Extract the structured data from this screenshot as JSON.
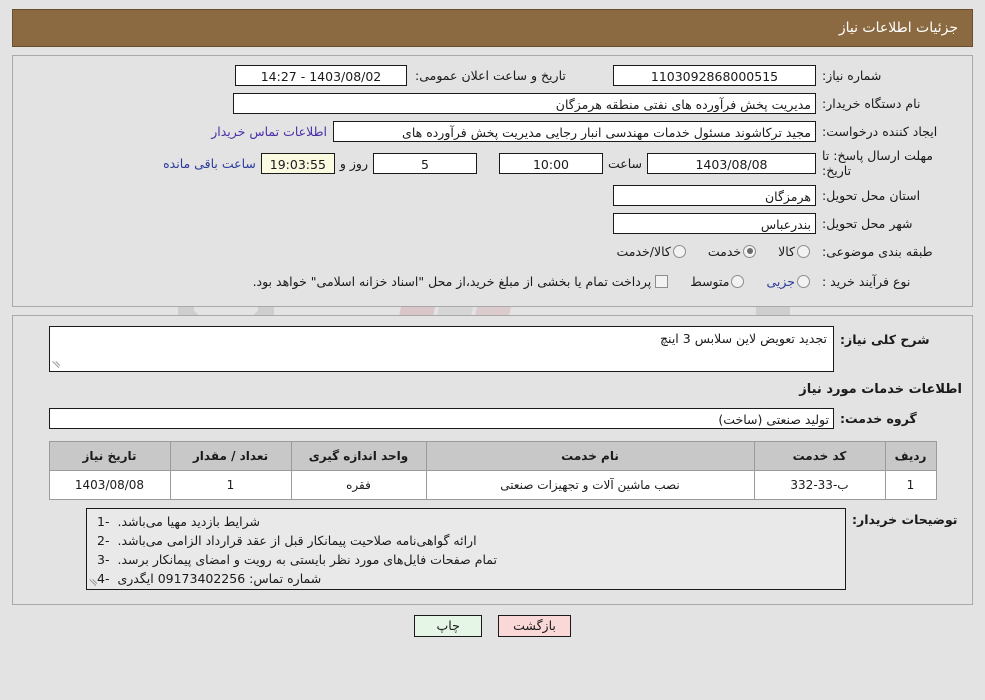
{
  "header": {
    "title": "جزئیات اطلاعات نیاز"
  },
  "info": {
    "need_number_label": "شماره نیاز:",
    "need_number_value": "1103092868000515",
    "announce_label": "تاریخ و ساعت اعلان عمومی:",
    "announce_value": "1403/08/02 - 14:27",
    "buyer_org_label": "نام دستگاه خریدار:",
    "buyer_org_value": "مدیریت پخش فرآورده های نفتی منطقه هرمزگان",
    "requester_label": "ایجاد کننده درخواست:",
    "requester_value": "مجید ترکاشوند مسئول خدمات مهندسی انبار رجایی مدیریت پخش فرآورده های",
    "contact_link": "اطلاعات تماس خریدار",
    "deadline_label": "مهلت ارسال پاسخ: تا تاریخ:",
    "deadline_date": "1403/08/08",
    "hour_label": "ساعت",
    "deadline_time": "10:00",
    "days_value": "5",
    "days_label": "روز و",
    "countdown_value": "19:03:55",
    "remaining_label": "ساعت باقی مانده",
    "province_label": "استان محل تحویل:",
    "province_value": "هرمزگان",
    "city_label": "شهر محل تحویل:",
    "city_value": "بندرعباس",
    "category_label": "طبقه بندی موضوعی:",
    "category_options": [
      {
        "label": "کالا",
        "selected": false
      },
      {
        "label": "خدمت",
        "selected": true
      },
      {
        "label": "کالا/خدمت",
        "selected": false
      }
    ],
    "process_label": "نوع فرآیند خرید :",
    "process_options": [
      {
        "label": "جزیی",
        "selected": false
      },
      {
        "label": "متوسط",
        "selected": false
      }
    ],
    "treasury_note": "پرداخت تمام یا بخشی از مبلغ خرید،از محل \"اسناد خزانه اسلامی\" خواهد بود."
  },
  "detail": {
    "summary_label": "شرح کلی نیاز:",
    "summary_value": "تجدید تعویض لاین سلابس 3 اینچ",
    "services_section_title": "اطلاعات خدمات مورد نیاز",
    "service_group_label": "گروه خدمت:",
    "service_group_value": "تولید صنعتی (ساخت)",
    "table": {
      "headers": [
        "ردیف",
        "کد خدمت",
        "نام خدمت",
        "واحد اندازه گیری",
        "تعداد / مقدار",
        "تاریخ نیاز"
      ],
      "rows": [
        {
          "index": "1",
          "code": "ب-33-332",
          "name": "نصب ماشین آلات و تجهیزات صنعتی",
          "unit": "فقره",
          "qty": "1",
          "date": "1403/08/08"
        }
      ]
    },
    "notes_label": "توضیحات خریدار:",
    "notes": [
      {
        "num": "1-",
        "text": "شرایط بازدید مهیا می‌باشد."
      },
      {
        "num": "2-",
        "text": "ارائه گواهی‌نامه صلاحیت پیمانکار قبل از عقد قرارداد الزامی می‌باشد."
      },
      {
        "num": "3-",
        "text": "تمام صفحات فایل‌های مورد نظر بایستی به رویت و امضای پیمانکار برسد."
      },
      {
        "num": "4-",
        "text": "شماره تماس: 09173402256 ایگدری"
      }
    ]
  },
  "footer": {
    "back_label": "بازگشت",
    "print_label": "چاپ"
  },
  "watermark": {
    "text": "AriaTender.net"
  }
}
